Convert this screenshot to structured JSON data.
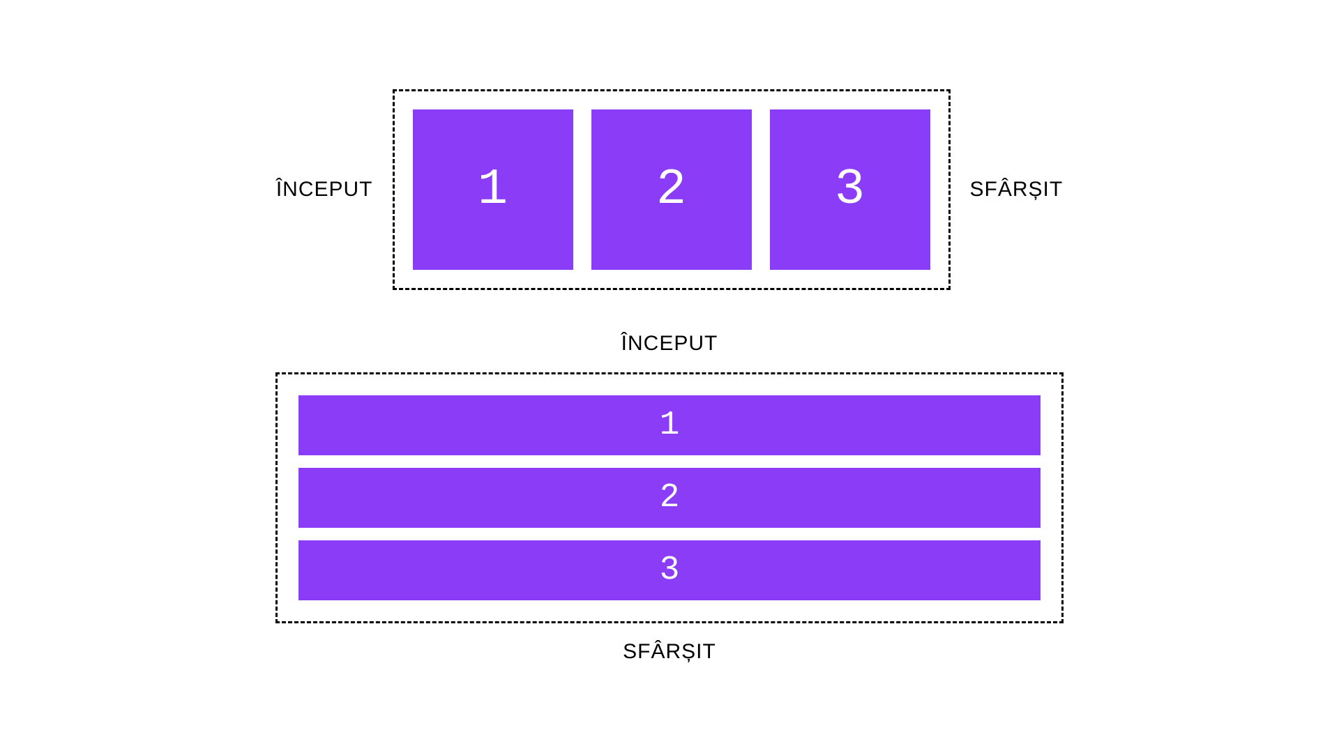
{
  "labels": {
    "start": "ÎNCEPUT",
    "end": "SFÂRȘIT"
  },
  "row_items": [
    "1",
    "2",
    "3"
  ],
  "col_items": [
    "1",
    "2",
    "3"
  ],
  "colors": {
    "item_bg": "#8b3cf7",
    "item_fg": "#ffffff",
    "border": "#000000"
  }
}
